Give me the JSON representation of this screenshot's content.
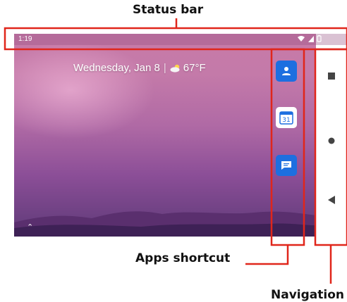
{
  "callouts": {
    "status_bar": "Status bar",
    "apps_shortcut": "Apps shortcut",
    "navigation": "Navigation"
  },
  "status_bar": {
    "time": "1:19",
    "icons": [
      "wifi-icon",
      "cell-signal-icon",
      "battery-icon"
    ]
  },
  "home": {
    "date": "Wednesday, Jan 8",
    "temperature": "67°F",
    "weather_icon": "cloud-sun-icon"
  },
  "apps": [
    {
      "name": "contacts",
      "icon": "contacts-icon"
    },
    {
      "name": "calendar",
      "icon": "calendar-icon",
      "day": "31"
    },
    {
      "name": "messages",
      "icon": "messages-icon"
    }
  ],
  "navigation": {
    "buttons": [
      "recents-button",
      "home-button",
      "back-button"
    ]
  },
  "colors": {
    "callout_red": "#e0261b",
    "app_blue": "#1d6fe0"
  }
}
